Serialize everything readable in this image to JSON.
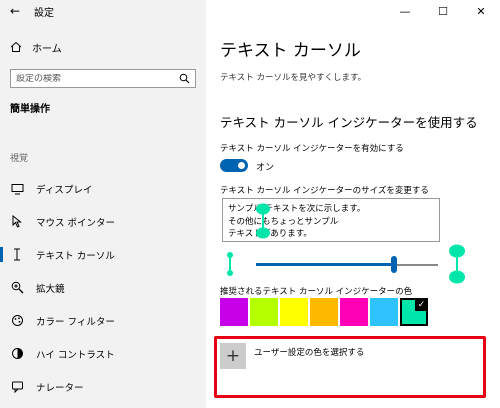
{
  "app": {
    "title": "設定"
  },
  "nav": {
    "home": "ホーム",
    "search_placeholder": "設定の検索",
    "section": "簡単操作",
    "category": "視覚",
    "items": [
      {
        "label": "ディスプレイ",
        "icon": "display-icon"
      },
      {
        "label": "マウス ポインター",
        "icon": "mouse-pointer-icon"
      },
      {
        "label": "テキスト カーソル",
        "icon": "text-cursor-icon",
        "active": true
      },
      {
        "label": "拡大鏡",
        "icon": "magnifier-icon"
      },
      {
        "label": "カラー フィルター",
        "icon": "color-filter-icon"
      },
      {
        "label": "ハイ コントラスト",
        "icon": "high-contrast-icon"
      },
      {
        "label": "ナレーター",
        "icon": "narrator-icon"
      }
    ]
  },
  "main": {
    "title": "テキスト カーソル",
    "subtitle": "テキスト カーソルを見やすくします。",
    "indicator_heading": "テキスト カーソル インジケーターを使用する",
    "toggle_label": "テキスト カーソル インジケーターを有効にする",
    "toggle_state": "オン",
    "size_label": "テキスト カーソル インジケーターのサイズを変更する",
    "sample_lines": [
      "サンプル テキストを次に示します。",
      "その他にもちょっとサンプル",
      "テキストがあります。"
    ],
    "size_slider": {
      "value": 0.76
    },
    "color_label": "推奨されるテキスト カーソル インジケーターの色",
    "swatches": [
      "#c800e8",
      "#b6ff00",
      "#ffff00",
      "#ffb900",
      "#ff00b6",
      "#2ec3ff",
      "#00e5aa"
    ],
    "selected_swatch": 6,
    "custom_color_label": "ユーザー設定の色を選択する"
  },
  "colors": {
    "accent": "#0063b1",
    "indicator": "#00e5aa",
    "highlight_box": "#e60012"
  }
}
